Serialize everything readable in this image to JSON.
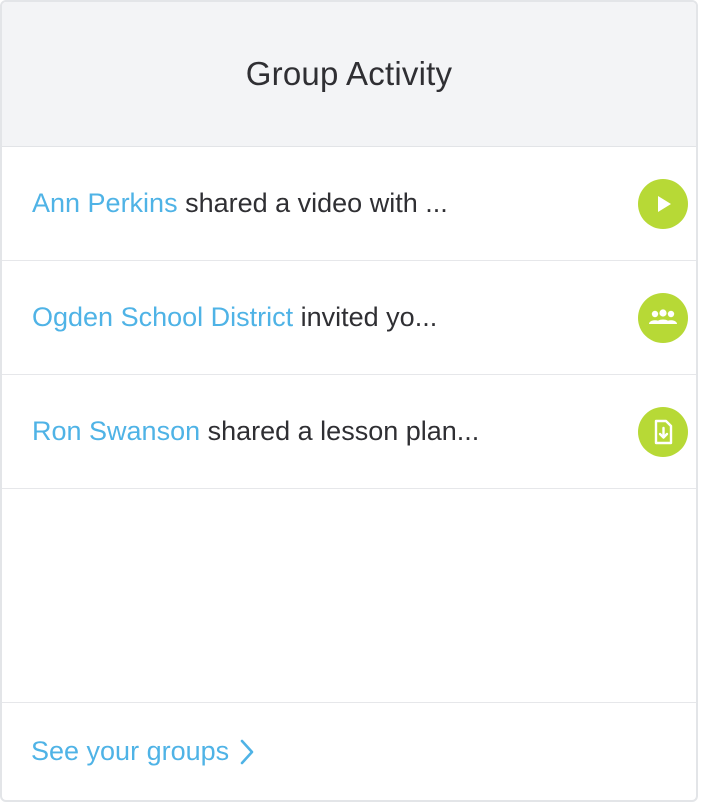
{
  "widget": {
    "title": "Group Activity"
  },
  "activities": [
    {
      "actor": "Ann Perkins",
      "text": " shared a video with ...",
      "icon": "play-icon"
    },
    {
      "actor": "Ogden School District",
      "text": " invited yo...",
      "icon": "group-icon"
    },
    {
      "actor": "Ron Swanson",
      "text": " shared a lesson plan...",
      "icon": "document-icon"
    }
  ],
  "footer": {
    "link_label": "See your groups",
    "link_icon": "chevron-right-icon"
  },
  "colors": {
    "accent_link": "#4fb3e6",
    "icon_badge": "#b7d936",
    "header_bg": "#f3f4f6",
    "text": "#2f2f33"
  }
}
